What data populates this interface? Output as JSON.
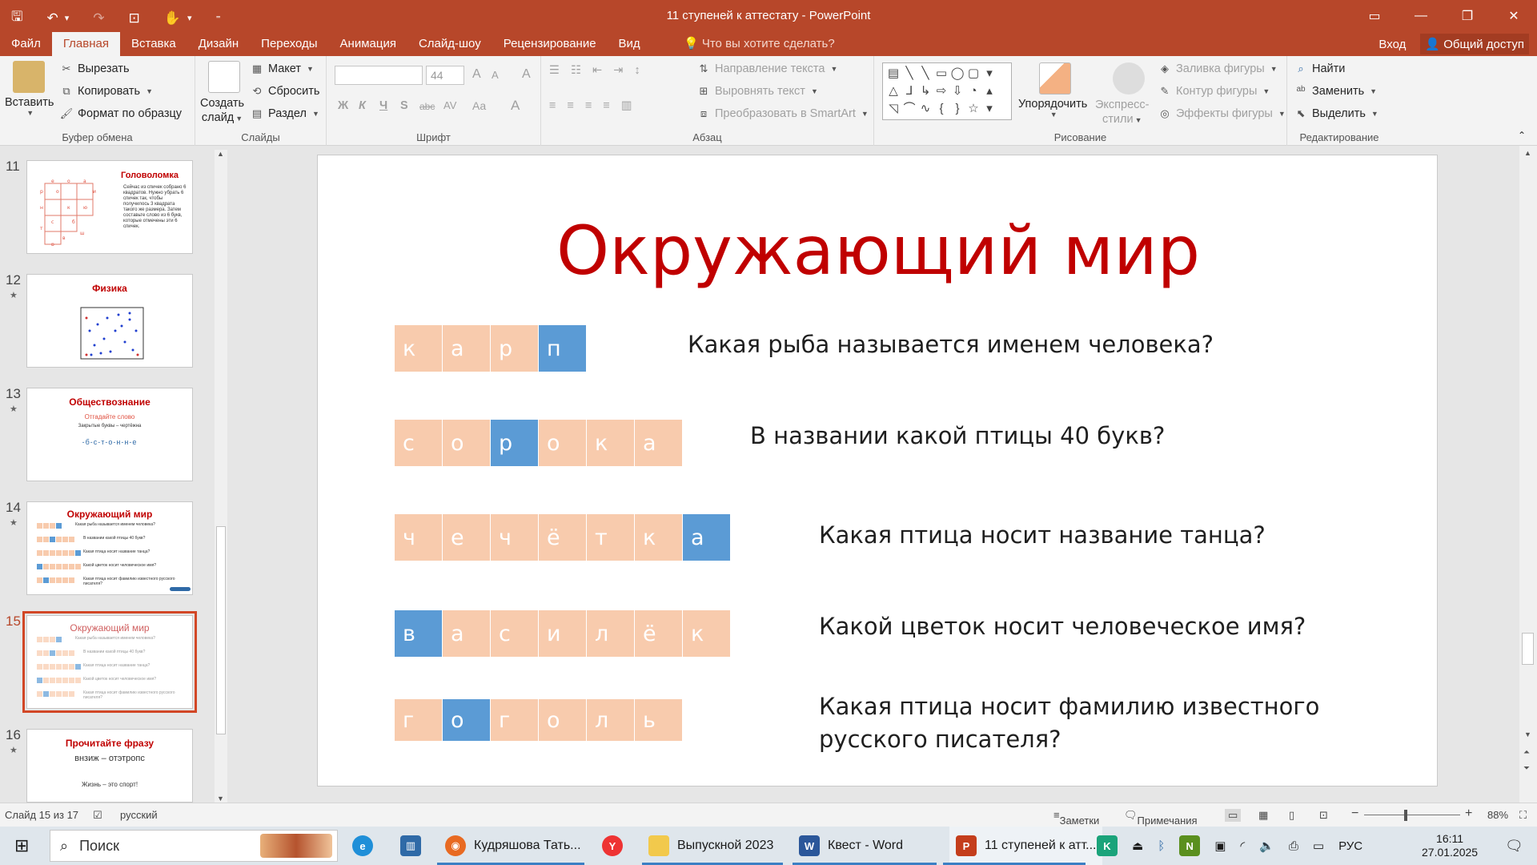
{
  "window": {
    "title": "11 ступеней к аттестату - PowerPoint",
    "controls": {
      "ribbon_display": "▭",
      "minimize": "—",
      "restore": "❐",
      "close": "✕"
    }
  },
  "qat": {
    "save": "🖫",
    "undo": "↶",
    "undo_dd": "▾",
    "redo": "↷",
    "present": "⊡",
    "touch": "✋",
    "touch_dd": "▾",
    "customize": "⁼"
  },
  "ribbon_tabs": [
    "Файл",
    "Главная",
    "Вставка",
    "Дизайн",
    "Переходы",
    "Анимация",
    "Слайд-шоу",
    "Рецензирование",
    "Вид"
  ],
  "tell_me": "Что вы хотите сделать?",
  "signin": "Вход",
  "share": "Общий доступ",
  "clipboard": {
    "paste": "Вставить",
    "cut": "Вырезать",
    "copy": "Копировать",
    "format_painter": "Формат по образцу",
    "label": "Буфер обмена"
  },
  "slides_group": {
    "new_slide_1": "Создать",
    "new_slide_2": "слайд",
    "layout": "Макет",
    "reset": "Сбросить",
    "section": "Раздел",
    "label": "Слайды"
  },
  "font_group": {
    "font_name": "",
    "font_size": "44",
    "bold": "Ж",
    "italic": "К",
    "underline": "Ч",
    "strike": "S",
    "shadow": "abc",
    "spacing": "AV",
    "case": "Aa",
    "color": "A",
    "grow": "A",
    "shrink": "A",
    "clear": "A",
    "label": "Шрифт"
  },
  "paragraph_group": {
    "text_direction": "Направление текста",
    "align_text": "Выровнять текст",
    "smartart": "Преобразовать в SmartArt",
    "label": "Абзац"
  },
  "drawing_group": {
    "arrange": "Упорядочить",
    "quick_styles_1": "Экспресс-",
    "quick_styles_2": "стили",
    "shape_fill": "Заливка фигуры",
    "shape_outline": "Контур фигуры",
    "shape_effects": "Эффекты фигуры",
    "label": "Рисование",
    "shapes": [
      "▤",
      "╲",
      "╲",
      "▭",
      "◯",
      "▢",
      "▾",
      "△",
      "⅃",
      "↳",
      "⇨",
      "⇩",
      "◔",
      "▴",
      "◹",
      "⌒",
      "∿",
      "{",
      "}",
      "☆",
      "▾"
    ]
  },
  "editing_group": {
    "find": "Найти",
    "replace": "Заменить",
    "select": "Выделить",
    "label": "Редактирование"
  },
  "thumbnails": [
    {
      "num": "11",
      "title": "Головоломка",
      "star": false,
      "desc": "Сейчас из спичек собрано 6 квадратов. Нужно убрать 6 спичек так, чтобы получилось 3 квадрата такого же размера. Затем составьте слово из 6 букв, которые отмечены эти 6 спичек.",
      "letters": [
        "е",
        "о",
        "а",
        "р",
        "о",
        "и",
        "к",
        "н",
        "ю",
        "с",
        "б",
        "т",
        "в",
        "р",
        "ш"
      ]
    },
    {
      "num": "12",
      "title": "Физика",
      "star": true
    },
    {
      "num": "13",
      "title": "Обществознание",
      "star": true,
      "subtitle": "Отгадайте слово",
      "line": "Закрытые буквы – чертёжна",
      "word": "-б-с-т-о-н-н-е"
    },
    {
      "num": "14",
      "title": "Окружающий мир",
      "star": true,
      "qs": [
        "Какая рыба называется именем человека?",
        "В названии какой птицы 40 букв?",
        "Какая птица носит название танца?",
        "Какой цветок носит человеческое имя?",
        "Какая птица носит фамилию известного русского писателя?"
      ]
    },
    {
      "num": "15",
      "title": "Окружающий мир",
      "star": true
    },
    {
      "num": "16",
      "title": "Прочитайте фразу",
      "star": true,
      "line": "внзиж – отэтропс",
      "answer": "Жизнь – это спорт!"
    }
  ],
  "slide": {
    "title": "Окружающий мир",
    "rows": [
      {
        "letters": [
          "к",
          "а",
          "р",
          "п"
        ],
        "hl": 3,
        "question": "Какая рыба называется именем человека?"
      },
      {
        "letters": [
          "с",
          "о",
          "р",
          "о",
          "к",
          "а"
        ],
        "hl": 2,
        "question": "В названии какой птицы 40 букв?"
      },
      {
        "letters": [
          "ч",
          "е",
          "ч",
          "ё",
          "т",
          "к",
          "а"
        ],
        "hl": 6,
        "question": "Какая птица носит название танца?"
      },
      {
        "letters": [
          "в",
          "а",
          "с",
          "и",
          "л",
          "ё",
          "к"
        ],
        "hl": 0,
        "question": "Какой цветок носит человеческое имя?"
      },
      {
        "letters": [
          "г",
          "о",
          "г",
          "о",
          "л",
          "ь"
        ],
        "hl": 1,
        "question_1": "Какая птица носит фамилию известного",
        "question_2": "русского писателя?"
      }
    ]
  },
  "status": {
    "slide_num": "Слайд 15 из 17",
    "lang": "русский",
    "notes": "Заметки",
    "comments": "Примечания",
    "zoom": "88%",
    "minus": "−",
    "plus": "+"
  },
  "taskbar": {
    "search": "Поиск",
    "firefox": "Кудряшова Тать...",
    "folder": "Выпускной 2023",
    "word": "Квест - Word",
    "ppt": "11 ступеней к атт...",
    "lang": "РУС",
    "time": "16:11",
    "date": "27.01.2025"
  },
  "colors": {
    "accent": "#b7472a",
    "title_red": "#c00000",
    "cell": "#f8cbad",
    "cell_hl": "#5b9bd5"
  }
}
